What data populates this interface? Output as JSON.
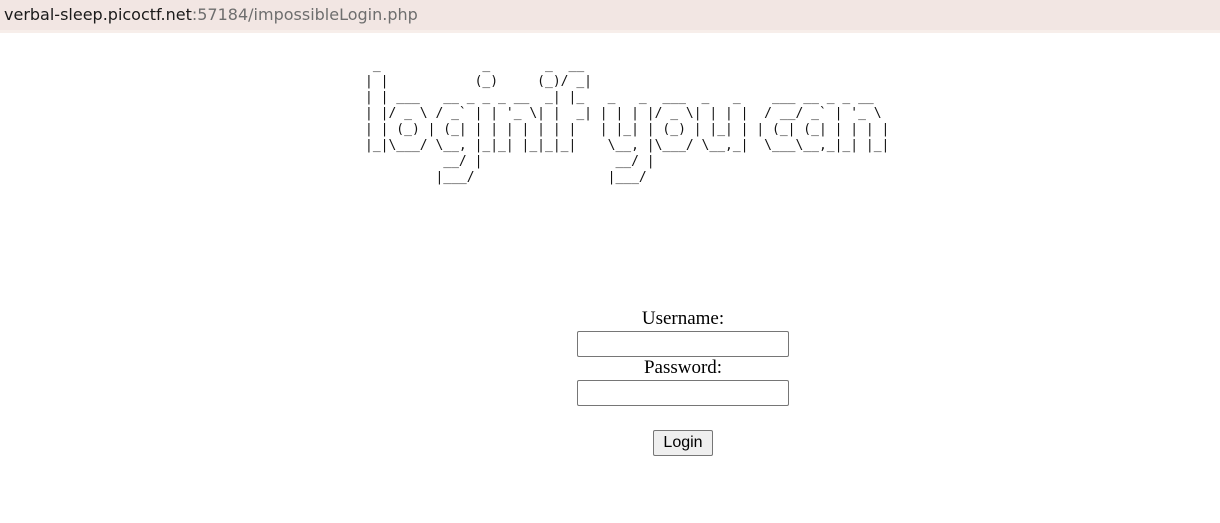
{
  "browser": {
    "url_host": "verbal-sleep.picoctf.net",
    "url_rest": ":57184/impossibleLogin.php"
  },
  "banner": {
    "ascii_art": " _             _       _  __\n| |           (_)     (_)/ _|\n| | ___   __ _ _ _ __  _| |_   _   _  ___  _   _    ___ __ _ _ __\n| |/ _ \\ / _` | | '_ \\| |  _| | | | |/ _ \\| | | |  / __/ _` | '_ \\\n| | (_) | (_| | | | | | | |   | |_| | (_) | |_| | | (_| (_| | | | |\n|_|\\___/ \\__, |_|_| |_|_|_|    \\__, |\\___/ \\__,_|  \\___\\__,_|_| |_|\n          __/ |                 __/ |\n         |___/                 |___/"
  },
  "form": {
    "username_label": "Username:",
    "username_value": "",
    "password_label": "Password:",
    "password_value": "",
    "submit_label": "Login"
  }
}
